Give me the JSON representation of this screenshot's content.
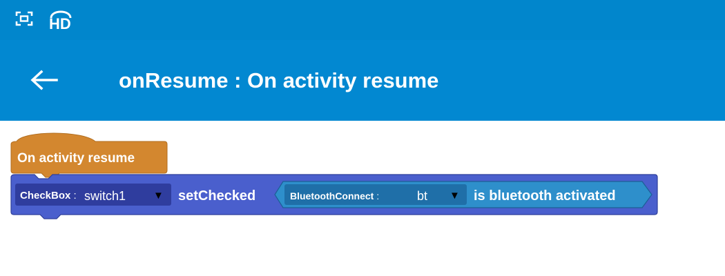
{
  "status_bar": {
    "icons": [
      "screenshot-icon",
      "hd-voice-icon"
    ],
    "hd_text": "HD"
  },
  "app_bar": {
    "back_icon": "back-arrow-icon",
    "title": "onResume : On activity resume"
  },
  "blocks": {
    "event_block": {
      "label": "On activity resume",
      "color": "#d3872f"
    },
    "statement_block": {
      "component_class": "CheckBox",
      "separator": ":",
      "component_value": "switch1",
      "dropdown_arrow": "▼",
      "method": "setChecked",
      "color": "#4a5fcd"
    },
    "argument_block": {
      "component_class": "BluetoothConnect",
      "separator": ":",
      "component_value": "bt",
      "dropdown_arrow": "▼",
      "method": "is bluetooth activated",
      "color": "#2e8fcb"
    }
  }
}
